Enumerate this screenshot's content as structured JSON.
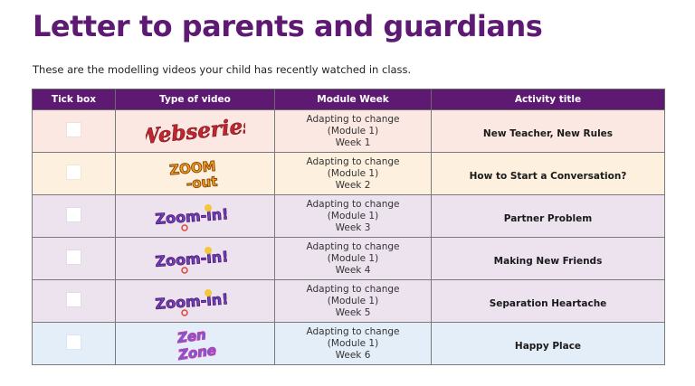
{
  "title": "Letter to parents and guardians",
  "intro": "These are the modelling videos your child has recently watched in class.",
  "columns": [
    "Tick box",
    "Type of video",
    "Module Week",
    "Activity title"
  ],
  "rows": [
    {
      "video_type": "Webseries",
      "logo": "webseries",
      "module": "Adapting to change",
      "module_no": "(Module 1)",
      "week": "Week 1",
      "activity": "New Teacher, New Rules"
    },
    {
      "video_type": "Zoom-out",
      "logo": "zoomout",
      "module": "Adapting to change",
      "module_no": "(Module 1)",
      "week": "Week 2",
      "activity": "How to Start a Conversation?"
    },
    {
      "video_type": "Zoom-in!",
      "logo": "zoomin",
      "module": "Adapting to change",
      "module_no": "(Module 1)",
      "week": "Week 3",
      "activity": "Partner Problem"
    },
    {
      "video_type": "Zoom-in!",
      "logo": "zoomin",
      "module": "Adapting to change",
      "module_no": "(Module 1)",
      "week": "Week 4",
      "activity": "Making New Friends"
    },
    {
      "video_type": "Zoom-in!",
      "logo": "zoomin",
      "module": "Adapting to change",
      "module_no": "(Module 1)",
      "week": "Week 5",
      "activity": "Separation Heartache"
    },
    {
      "video_type": "Zen Zone",
      "logo": "zen",
      "module": "Adapting to change",
      "module_no": "(Module 1)",
      "week": "Week 6",
      "activity": "Happy Place"
    }
  ],
  "colors": {
    "header": "#5e1a73",
    "title": "#5e1a73"
  }
}
